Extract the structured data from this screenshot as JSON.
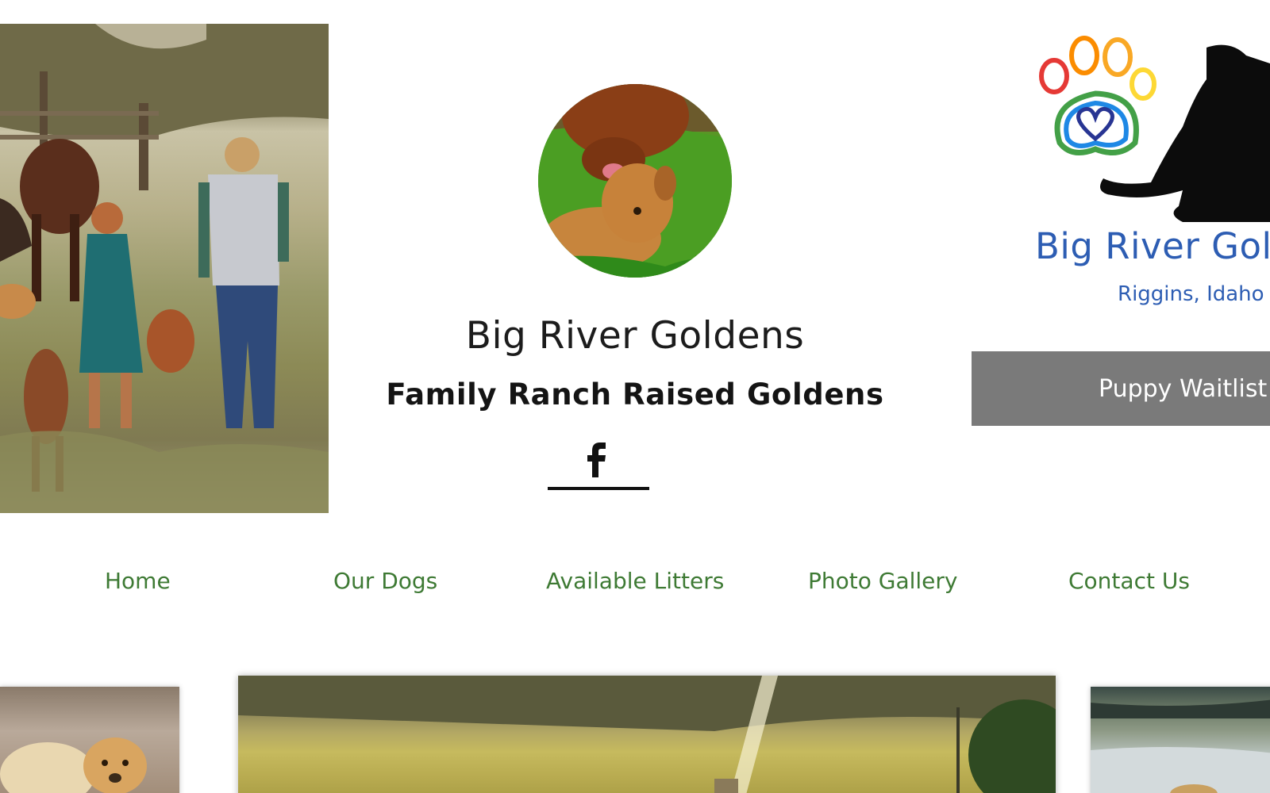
{
  "header": {
    "site_title": "Big River Goldens",
    "subtitle": "Family Ranch Raised Goldens",
    "social_icon": "facebook-icon"
  },
  "logo": {
    "name": "Big River Goldens",
    "location": "Riggins, Idaho",
    "paw_colors": [
      "#e53935",
      "#fb8c00",
      "#fdd835",
      "#43a047",
      "#1e88e5",
      "#283593"
    ]
  },
  "cta": {
    "waitlist_label": "Puppy Waitlist"
  },
  "nav": {
    "items": [
      {
        "label": "Home"
      },
      {
        "label": "Our Dogs"
      },
      {
        "label": "Available Litters"
      },
      {
        "label": "Photo Gallery"
      },
      {
        "label": "Contact Us"
      }
    ]
  },
  "colors": {
    "nav_text": "#3e7a34",
    "button_bg": "#7a7a7a",
    "logo_text": "#2d5db3",
    "title_text": "#1c1c1c"
  }
}
